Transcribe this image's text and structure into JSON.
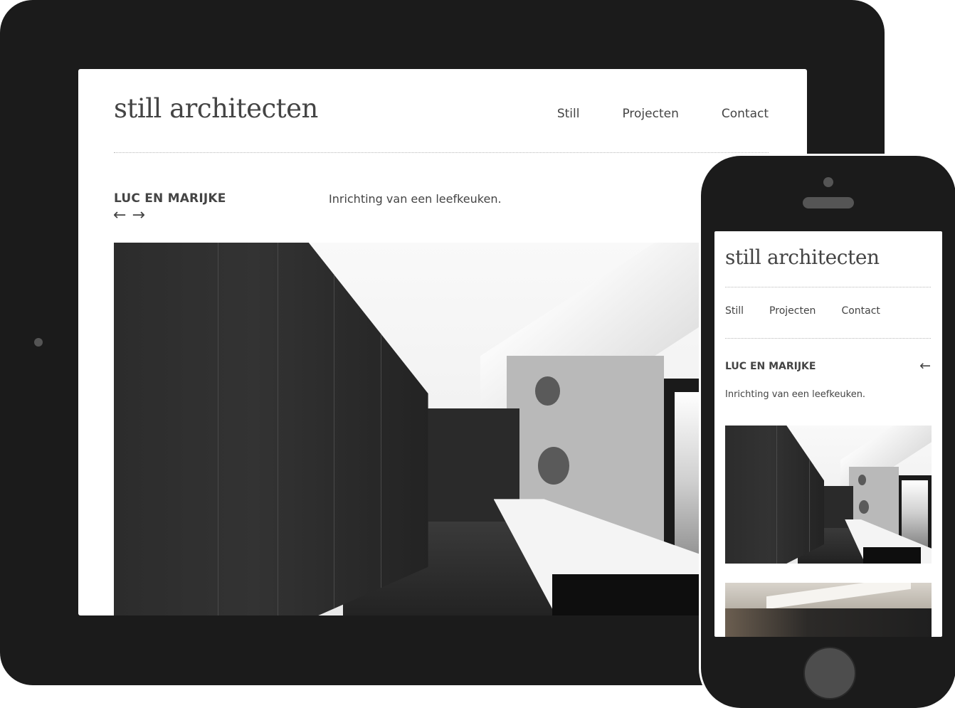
{
  "tablet": {
    "site": {
      "logo": "still architecten",
      "nav": [
        "Still",
        "Projecten",
        "Contact"
      ]
    },
    "project": {
      "title": "LUC EN MARIJKE",
      "arrow_prev": "←",
      "arrow_next": "→",
      "description": "Inrichting van een leefkeuken."
    },
    "image": {
      "alt": "kitchen-photo"
    }
  },
  "phone": {
    "site": {
      "logo": "still architecten",
      "nav": [
        "Still",
        "Projecten",
        "Contact"
      ]
    },
    "project": {
      "title": "LUC EN MARIJKE",
      "arrow_prev": "←",
      "description": "Inrichting van een leefkeuken."
    }
  },
  "colors": {
    "device": "#1b1b1b",
    "text": "#444444",
    "divider": "#b8b8b8"
  }
}
